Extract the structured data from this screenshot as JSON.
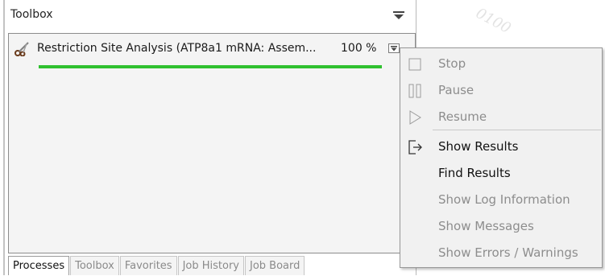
{
  "toolbox_panel": {
    "title": "Toolbox",
    "collapse_icon": "triangle-down-icon"
  },
  "process": {
    "icon": "scissors-icon",
    "name": "Restriction Site Analysis (ATP8a1 mRNA: Assem...",
    "percent_text": "100 %",
    "progress": 1.0,
    "progress_color": "#2fc12f",
    "menu_icon": "dropdown-toggle-icon"
  },
  "tabs": [
    {
      "label": "Processes",
      "active": true
    },
    {
      "label": "Toolbox",
      "active": false
    },
    {
      "label": "Favorites",
      "active": false
    },
    {
      "label": "Job History",
      "active": false
    },
    {
      "label": "Job Board",
      "active": false
    }
  ],
  "watermark": "0100",
  "context_menu": {
    "items": [
      {
        "label": "Stop",
        "icon": "stop-icon",
        "enabled": false
      },
      {
        "label": "Pause",
        "icon": "pause-icon",
        "enabled": false
      },
      {
        "label": "Resume",
        "icon": "play-icon",
        "enabled": false
      },
      {
        "label": "Show Results",
        "icon": "show-results-icon",
        "enabled": true
      },
      {
        "label": "Find Results",
        "icon": "",
        "enabled": true
      },
      {
        "label": "Show Log Information",
        "icon": "",
        "enabled": false
      },
      {
        "label": "Show Messages",
        "icon": "",
        "enabled": false
      },
      {
        "label": "Show Errors / Warnings",
        "icon": "",
        "enabled": false
      }
    ]
  }
}
